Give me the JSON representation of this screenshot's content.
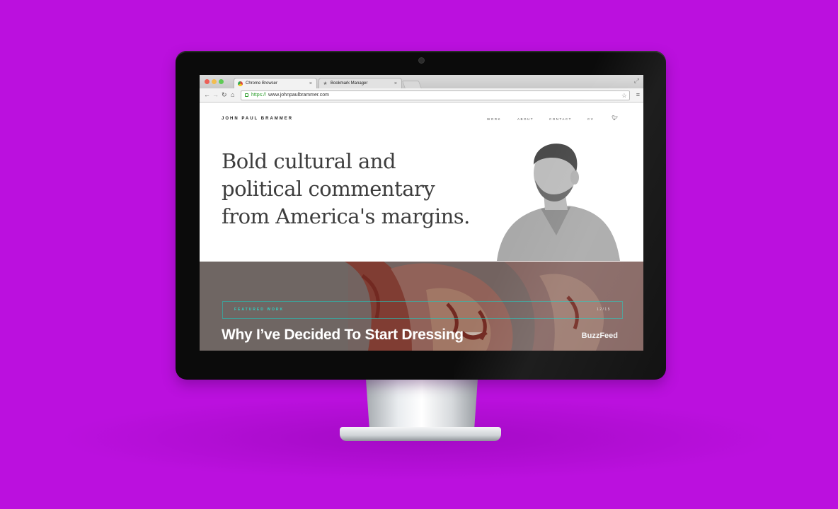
{
  "browser": {
    "tabs": [
      {
        "label": "Chrome Browser",
        "active": true,
        "favicon": "chrome-icon"
      },
      {
        "label": "Bookmark Manager",
        "active": false,
        "favicon": "star-icon"
      }
    ],
    "tab_close_glyph": "×",
    "address": {
      "scheme": "https://",
      "rest": "www.johnpaulbrammer.com"
    }
  },
  "site": {
    "logo": "JOHN PAUL BRAMMER",
    "nav": {
      "work": "WORK",
      "about": "ABOUT",
      "contact": "CONTACT",
      "cv": "CV"
    },
    "hero": {
      "lines": [
        "Bold cultural and",
        "political commentary",
        "from America's margins."
      ]
    },
    "featured": {
      "label": "FEATURED WORK",
      "date": "12/15",
      "title": "Why I’ve Decided To Start Dressing",
      "source": "BuzzFeed"
    }
  },
  "colors": {
    "background": "#bb10de",
    "accent_teal": "#2fd3c5"
  }
}
